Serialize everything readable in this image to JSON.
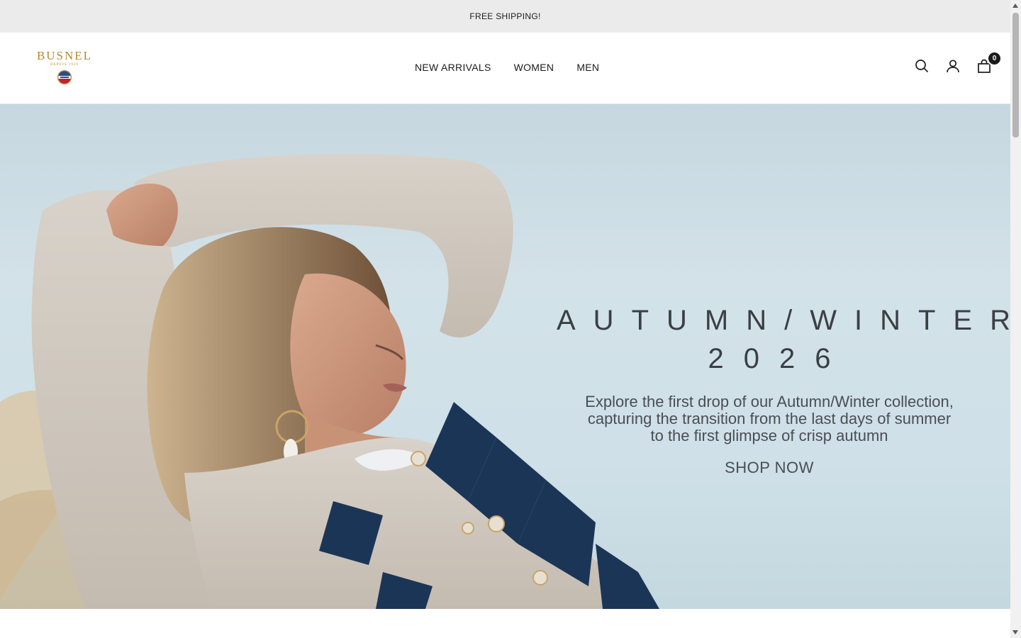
{
  "announcement": {
    "text": "FREE SHIPPING!"
  },
  "header": {
    "logo": {
      "wordmark": "BUSNEL",
      "tagline": "DEPUIS 1920"
    },
    "nav": [
      {
        "label": "NEW ARRIVALS"
      },
      {
        "label": "WOMEN"
      },
      {
        "label": "MEN"
      }
    ],
    "icons": {
      "search": "search-icon",
      "account": "account-icon",
      "cart": "cart-icon"
    },
    "cart_count": "0"
  },
  "hero": {
    "title": "AUTUMN/WINTER",
    "year": "2026",
    "description_lines": [
      "Explore the first drop of our Autumn/Winter collection,",
      "capturing the transition from the last days of summer",
      "to the first glimpse of crisp autumn"
    ],
    "cta": "SHOP NOW"
  },
  "colors": {
    "announcement_bg": "#ebebeb",
    "text": "#1c1b1b",
    "logo_gold": "#b08a2e",
    "hero_sky": "#cfe0e8",
    "sweater_navy": "#1b3556",
    "sweater_beige": "#cfc6bb"
  }
}
